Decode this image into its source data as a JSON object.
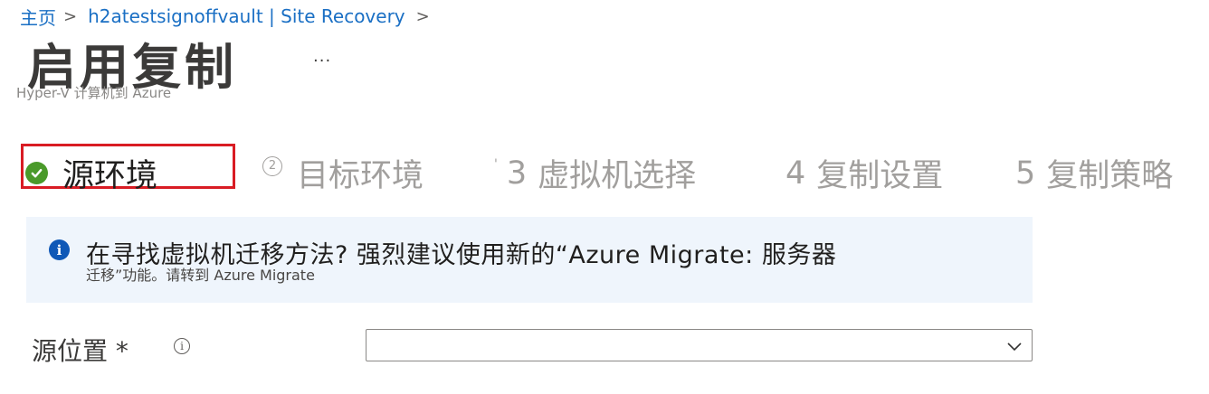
{
  "breadcrumb": {
    "home": "主页",
    "separator": ">",
    "vault": "h2atestsignoffvault | Site Recovery",
    "trailing_chevron": ">"
  },
  "page": {
    "title": "启用复制",
    "more": "...",
    "subtitle": "Hyper-V 计算机到 Azure"
  },
  "steps": [
    {
      "number": "",
      "label": "源环境",
      "state": "completed"
    },
    {
      "number": "2",
      "label": "目标环境",
      "state": "inactive"
    },
    {
      "number": "3",
      "label": "虚拟机选择",
      "state": "inactive"
    },
    {
      "number": "4",
      "label": "复制设置",
      "state": "inactive"
    },
    {
      "number": "5",
      "label": "复制策略",
      "state": "inactive"
    }
  ],
  "info_banner": {
    "icon": "info-icon",
    "line1": "在寻找虚拟机迁移方法? 强烈建议使用新的“Azure  Migrate: 服务器",
    "line2": "迁移”功能。请转到 Azure Migrate"
  },
  "form": {
    "source_location_label": "源位置 *",
    "source_location_value": ""
  },
  "colors": {
    "link": "#1a6fc4",
    "active_step_border": "#d91c24",
    "check": "#4a9a2a",
    "info_bg": "#eff5fc",
    "info_icon": "#0f58b7"
  }
}
